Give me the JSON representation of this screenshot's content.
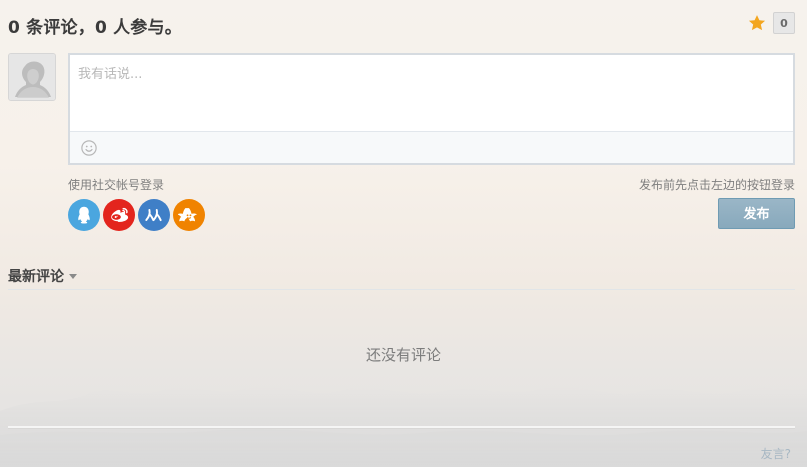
{
  "header": {
    "title": "0 条评论，0 人参与。",
    "count_badge": "0"
  },
  "compose": {
    "placeholder": "我有话说..."
  },
  "social": {
    "login_label": "使用社交帐号登录",
    "providers": [
      {
        "name": "qq",
        "color": "#4aa6df"
      },
      {
        "name": "weibo",
        "color": "#e3251d"
      },
      {
        "name": "renren",
        "color": "#3f7fc7"
      },
      {
        "name": "douban",
        "color": "#f08300"
      }
    ],
    "hint_right": "发布前先点击左边的按钮登录"
  },
  "actions": {
    "publish_label": "发布"
  },
  "comments": {
    "sort_label": "最新评论",
    "empty_text": "还没有评论"
  },
  "footer": {
    "link_text": "友言?"
  },
  "icons": {
    "star": "star-icon",
    "emoji": "emoji-icon",
    "avatar": "default-avatar",
    "caret": "chevron-down-icon",
    "social": [
      "qq-icon",
      "weibo-icon",
      "renren-icon",
      "douban-icon"
    ]
  },
  "colors": {
    "star": "#f3a620",
    "publish_bg": "#8fb0c3",
    "border": "#d6dbe0",
    "muted_text": "#7f7f7f"
  }
}
